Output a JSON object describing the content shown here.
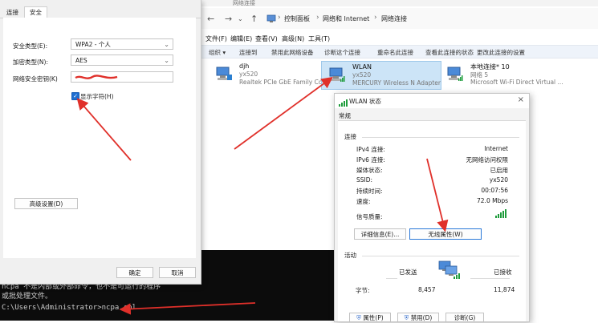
{
  "console": {
    "line1": "ncpa 不是内部或外部命令，也不是可运行的程序",
    "line2": "或批处理文件。",
    "prompt": "C:\\Users\\Administrator>ncpa.cpl"
  },
  "explorer": {
    "title": "网络连接",
    "breadcrumb": [
      "控制面板",
      "网络和 Internet",
      "网络连接"
    ],
    "menus": [
      "文件(F)",
      "编辑(E)",
      "查看(V)",
      "高级(N)",
      "工具(T)"
    ],
    "commands": [
      "组织 ▾",
      "连接到",
      "禁用此网络设备",
      "诊断这个连接",
      "重命名此连接",
      "查看此连接的状态",
      "更改此连接的设置"
    ],
    "connections": [
      {
        "name": "djh",
        "status": "yx520",
        "adapter": "Realtek PCIe GbE Family Contr..."
      },
      {
        "name": "WLAN",
        "status": "yx520",
        "adapter": "MERCURY Wireless N Adapter"
      },
      {
        "name": "本地连接* 10",
        "status": "网络 5",
        "adapter": "Microsoft Wi-Fi Direct Virtual ..."
      }
    ]
  },
  "wifi_props": {
    "tabs": [
      "连接",
      "安全"
    ],
    "security_type_label": "安全类型(E):",
    "security_type_value": "WPA2 - 个人",
    "encryption_label": "加密类型(N):",
    "encryption_value": "AES",
    "key_label": "网络安全密钥(K)",
    "show_chars_label": "显示字符(H)",
    "advanced_button": "高级设置(D)",
    "ok_button": "确定",
    "cancel_button": "取消"
  },
  "wlan_status": {
    "title": "WLAN 状态",
    "tab": "常规",
    "connection_group": "连接",
    "rows": [
      {
        "label": "IPv4 连接:",
        "value": "Internet"
      },
      {
        "label": "IPv6 连接:",
        "value": "无网络访问权限"
      },
      {
        "label": "媒体状态:",
        "value": "已启用"
      },
      {
        "label": "SSID:",
        "value": "yx520"
      },
      {
        "label": "持续时间:",
        "value": "00:07:56"
      },
      {
        "label": "速度:",
        "value": "72.0 Mbps"
      }
    ],
    "signal_label": "信号质量:",
    "details_button": "详细信息(E)...",
    "wireless_props_button": "无线属性(W)",
    "activity_group": "活动",
    "sent_label": "已发送",
    "received_label": "已接收",
    "bytes_label": "字节:",
    "bytes_sent": "8,457",
    "bytes_received": "11,874",
    "properties_button": "属性(P)",
    "disable_button": "禁用(D)",
    "diagnose_button": "诊断(G)"
  },
  "colors": {
    "arrow": "#e0302a",
    "signal": "#1e9c3c",
    "selection": "#cce4f7"
  }
}
